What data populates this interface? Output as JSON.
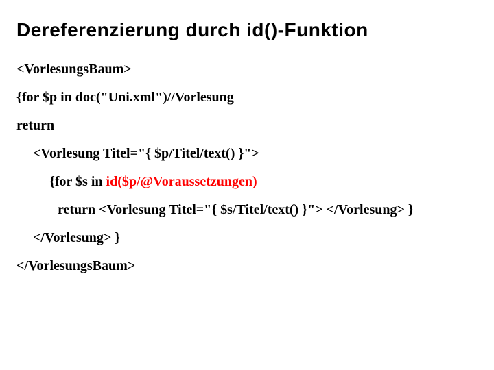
{
  "title": "Dereferenzierung durch id()-Funktion",
  "lines": {
    "l1": "<VorlesungsBaum>",
    "l2": "{for $p in doc(\"Uni.xml\")//Vorlesung",
    "l3": "return",
    "l4": "<Vorlesung Titel=\"{ $p/Titel/text() }\">",
    "l5_a": "{for $s in ",
    "l5_b": "id($p/@Voraussetzungen)",
    "l6": "return <Vorlesung Titel=\"{ $s/Titel/text() }\"> </Vorlesung> }",
    "l7": "</Vorlesung> }",
    "l8": "</VorlesungsBaum>"
  }
}
